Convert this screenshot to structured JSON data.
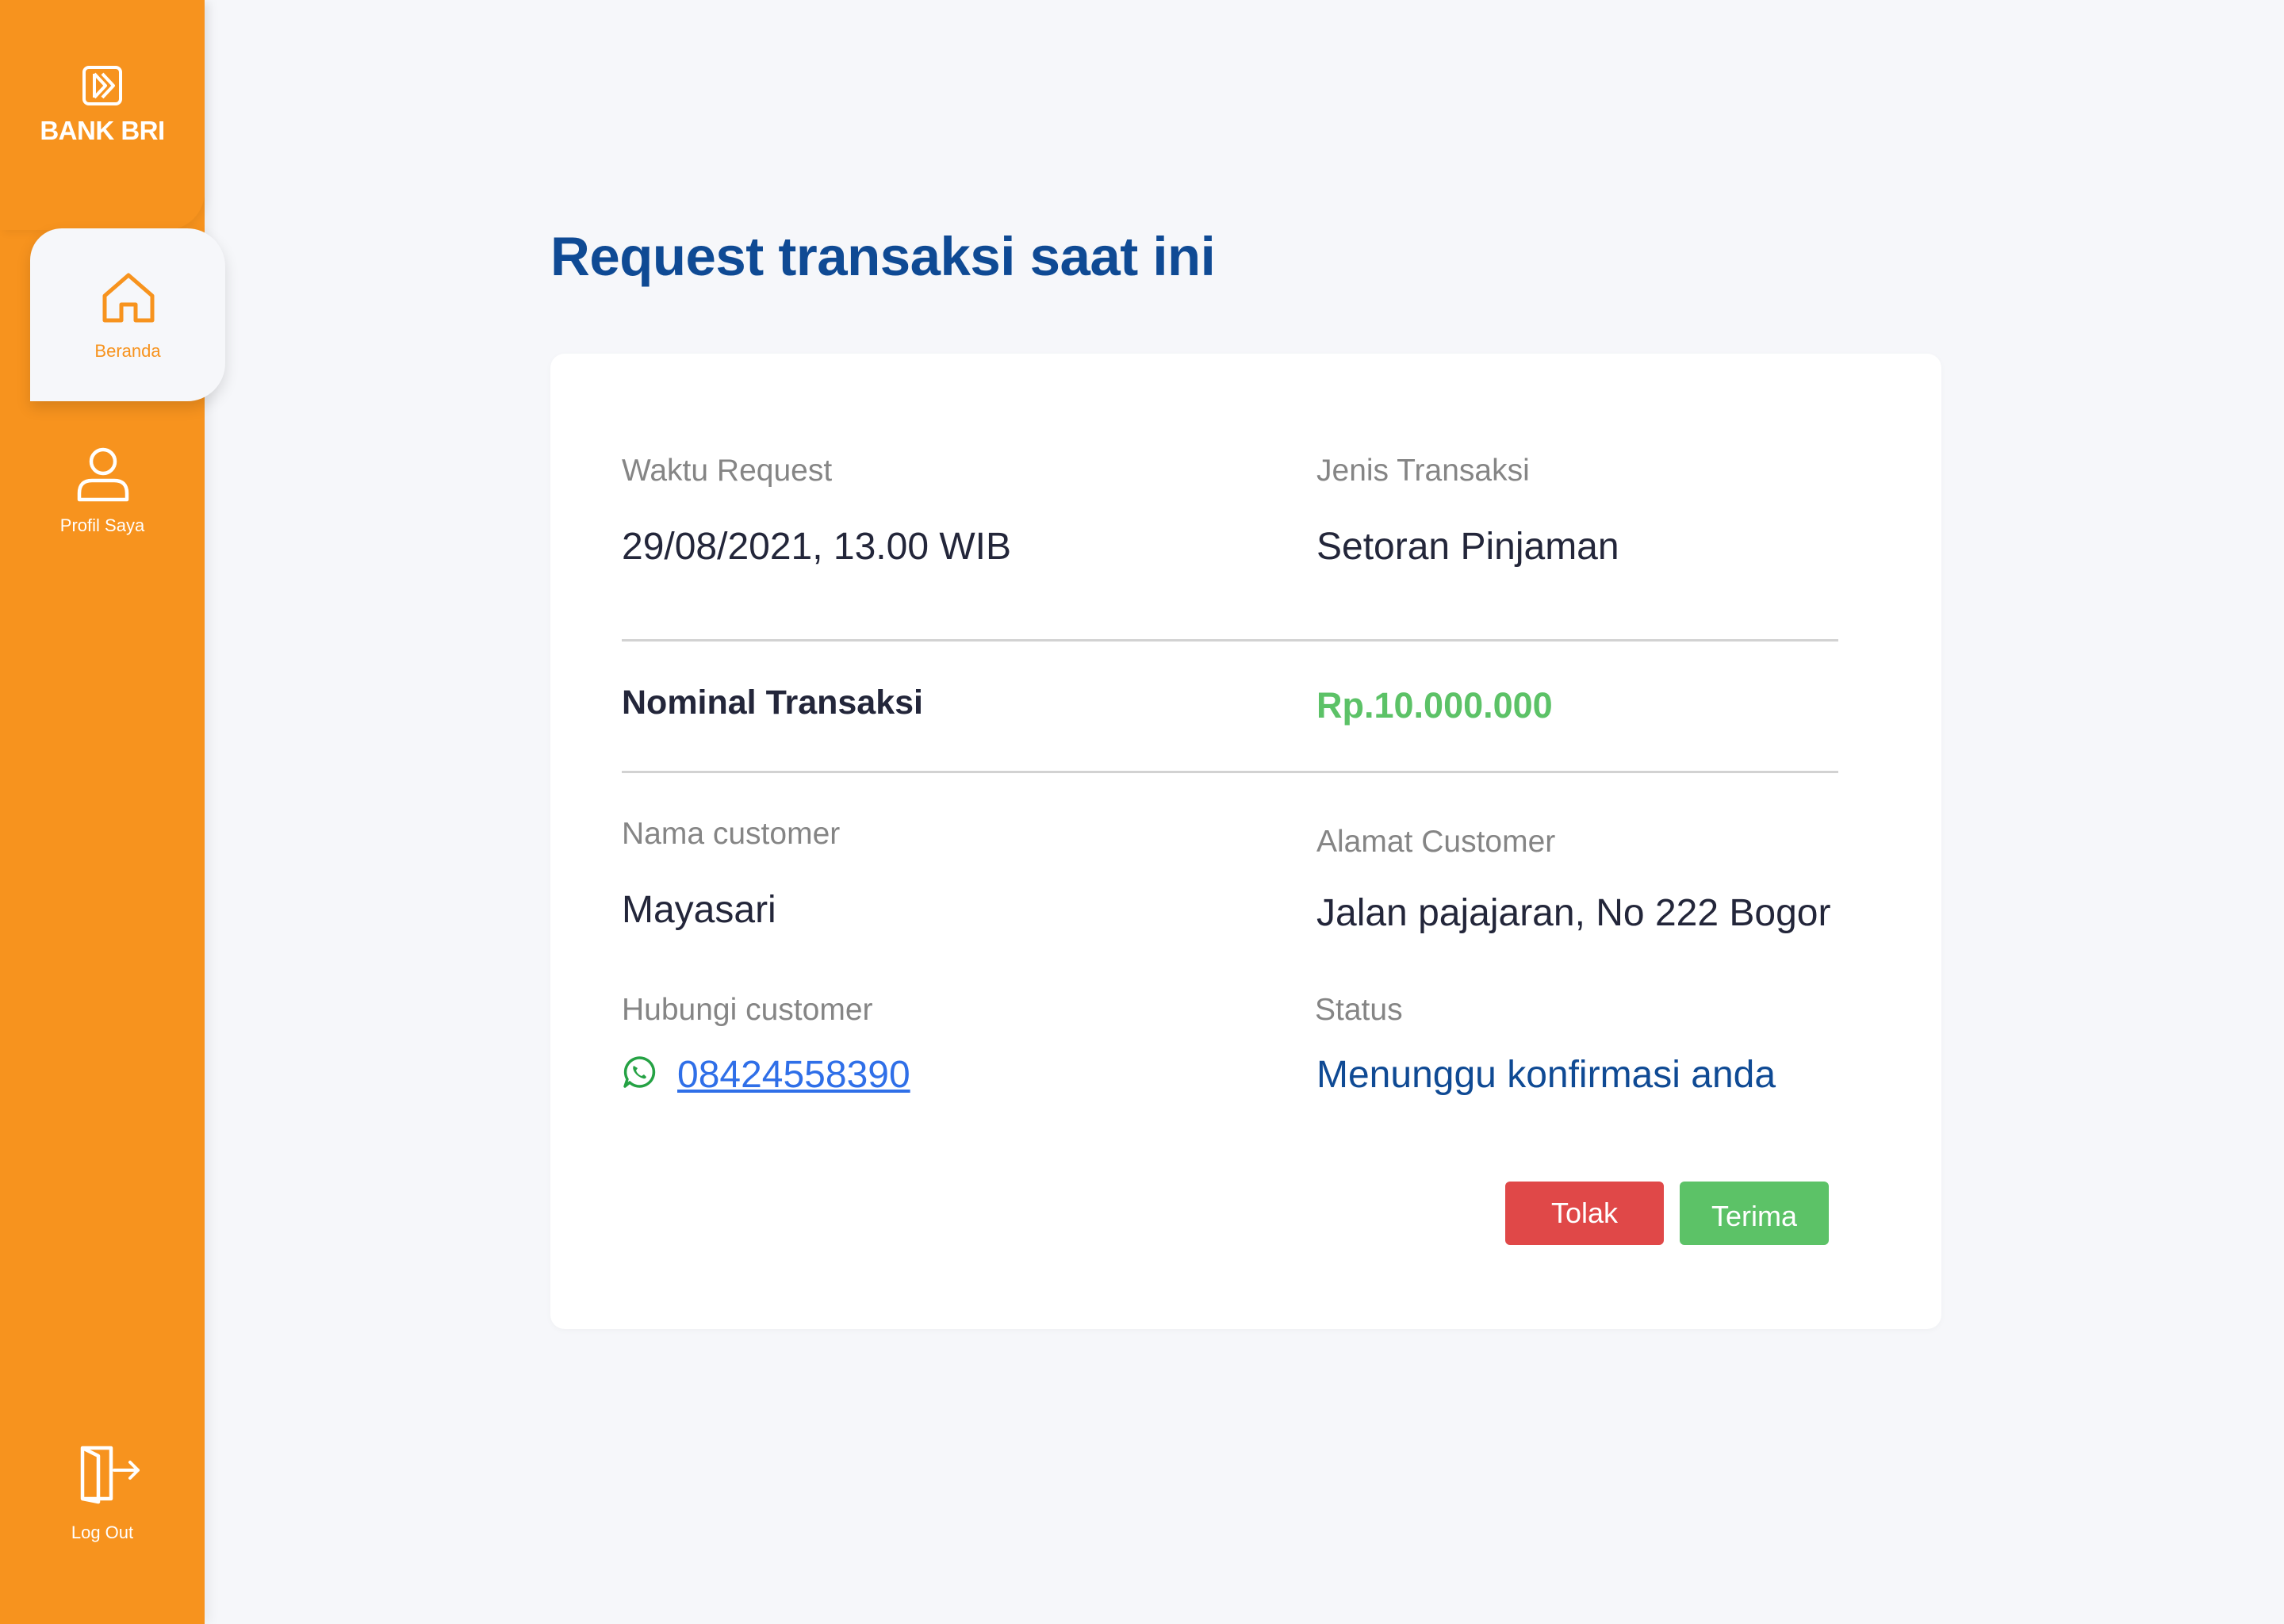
{
  "brand": {
    "name": "BANK BRI",
    "accent_color": "#f7931e",
    "primary_text_color": "#0f4a94"
  },
  "sidebar": {
    "items": [
      {
        "label": "Beranda",
        "icon": "home-icon",
        "active": true
      },
      {
        "label": "Profil Saya",
        "icon": "user-icon",
        "active": false
      }
    ],
    "logout": {
      "label": "Log Out",
      "icon": "logout-icon"
    }
  },
  "main": {
    "title": "Request transaksi saat ini",
    "request": {
      "waktu_label": "Waktu Request",
      "waktu_value": "29/08/2021, 13.00 WIB",
      "jenis_label": "Jenis Transaksi",
      "jenis_value": "Setoran Pinjaman",
      "nominal_label": "Nominal Transaksi",
      "nominal_value": "Rp.10.000.000",
      "nominal_color": "#5cc267",
      "nama_label": "Nama customer",
      "nama_value": "Mayasari",
      "alamat_label": "Alamat Customer",
      "alamat_value": "Jalan pajajaran, No 222 Bogor",
      "hubungi_label": "Hubungi customer",
      "phone": "08424558390",
      "phone_icon": "whatsapp-icon",
      "status_label": "Status",
      "status_value": "Menunggu konfirmasi anda"
    },
    "actions": {
      "reject_label": "Tolak",
      "reject_color": "#e04848",
      "accept_label": "Terima",
      "accept_color": "#5cc267"
    }
  }
}
